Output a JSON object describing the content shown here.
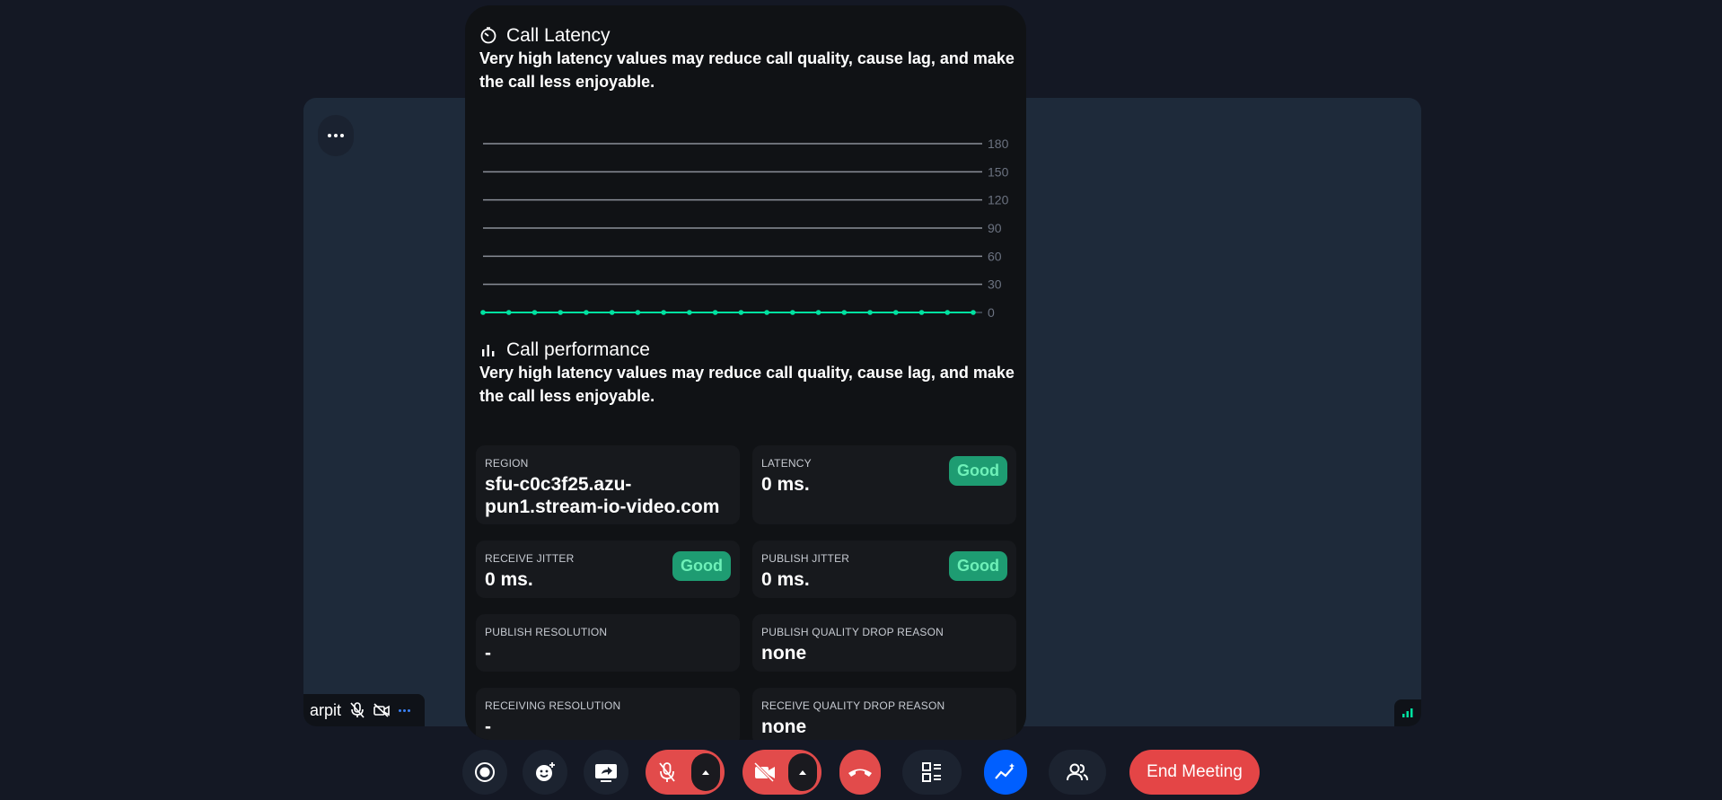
{
  "latency": {
    "title": "Call Latency",
    "description": "Very high latency values may reduce call quality, cause lag, and make the call less enjoyable."
  },
  "chart_data": {
    "type": "line",
    "title": "",
    "x": [
      1,
      2,
      3,
      4,
      5,
      6,
      7,
      8,
      9,
      10,
      11,
      12,
      13,
      14,
      15,
      16,
      17,
      18,
      19,
      20
    ],
    "series": [
      {
        "values": [
          0,
          0,
          0,
          0,
          0,
          0,
          0,
          0,
          0,
          0,
          0,
          0,
          0,
          0,
          0,
          0,
          0,
          0,
          0,
          0
        ]
      }
    ],
    "yticks": [
      "180",
      "150",
      "120",
      "90",
      "60",
      "30",
      "0"
    ],
    "ylim": [
      0,
      180
    ],
    "grid": true,
    "line_color": "#00e2a1"
  },
  "performance": {
    "title": "Call performance",
    "description": "Very high latency values may reduce call quality, cause lag, and make the call less enjoyable.",
    "stats": {
      "region": {
        "label": "REGION",
        "value": "sfu-c0c3f25.azu-pun1.stream-io-video.com"
      },
      "latency": {
        "label": "LATENCY",
        "value": "0 ms.",
        "badge": "Good"
      },
      "receive_jitter": {
        "label": "RECEIVE JITTER",
        "value": "0 ms.",
        "badge": "Good"
      },
      "publish_jitter": {
        "label": "PUBLISH JITTER",
        "value": "0 ms.",
        "badge": "Good"
      },
      "publish_resolution": {
        "label": "PUBLISH RESOLUTION",
        "value": "-"
      },
      "publish_drop": {
        "label": "PUBLISH QUALITY DROP REASON",
        "value": "none"
      },
      "receiving_resolution": {
        "label": "RECEIVING RESOLUTION",
        "value": "-"
      },
      "receive_drop": {
        "label": "RECEIVE QUALITY DROP REASON",
        "value": "none"
      }
    }
  },
  "participant": {
    "name": "arpit"
  },
  "controls": {
    "end_meeting": "End Meeting"
  },
  "colors": {
    "good_badge_bg": "#1e9c72",
    "good_badge_text": "#6ef0b8",
    "danger": "#e24b4b",
    "accent_blue": "#005fff"
  }
}
